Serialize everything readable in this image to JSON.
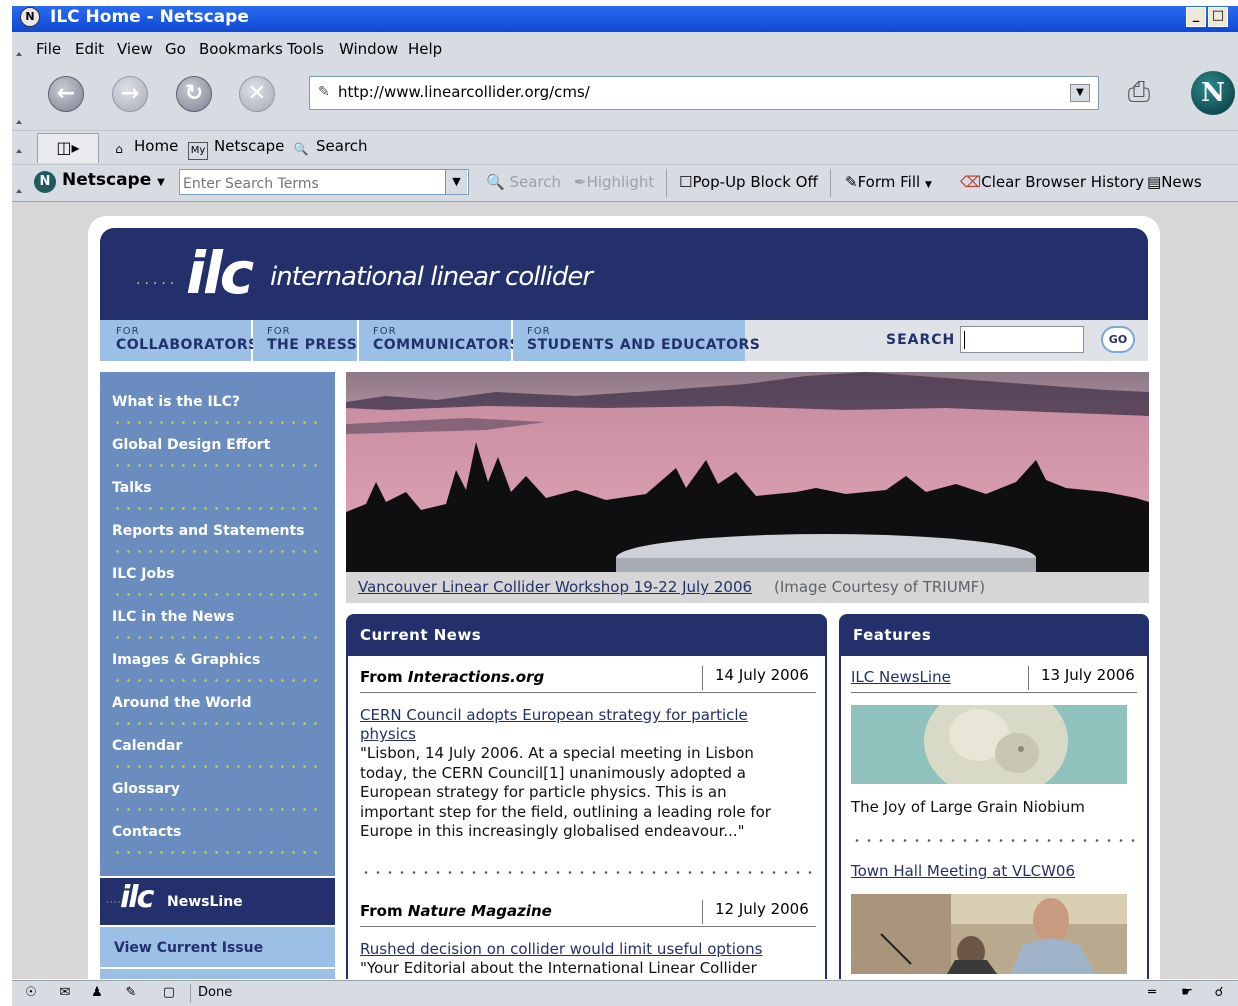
{
  "window": {
    "title": "ILC Home - Netscape",
    "controls": [
      "_",
      "□"
    ]
  },
  "menubar": [
    "File",
    "Edit",
    "View",
    "Go",
    "Bookmarks",
    "Tools",
    "Window",
    "Help"
  ],
  "navigation": {
    "url": "http://www.linearcollider.org/cms/"
  },
  "personal_toolbar": {
    "home": "Home",
    "netscape": "Netscape",
    "search": "Search"
  },
  "search_toolbar": {
    "brand": "Netscape",
    "search_placeholder": "Enter Search Terms",
    "search_btn": "Search",
    "highlight_btn": "Highlight",
    "popup": "Pop-Up Block Off",
    "formfill": "Form Fill",
    "clear_history": "Clear Browser History",
    "news": "News"
  },
  "status": {
    "text": "Done"
  },
  "site": {
    "logo_text": "ilc",
    "name": "international linear collider",
    "audience_tabs": [
      {
        "for": "FOR",
        "label": "COLLABORATORS"
      },
      {
        "for": "FOR",
        "label": "THE PRESS"
      },
      {
        "for": "FOR",
        "label": "COMMUNICATORS"
      },
      {
        "for": "FOR",
        "label": "STUDENTS AND EDUCATORS"
      }
    ],
    "search_label": "SEARCH",
    "go_label": "GO",
    "left_nav": [
      "What is the ILC?",
      "Global Design Effort",
      "Talks",
      "Reports and Statements",
      "ILC Jobs",
      "ILC in the News",
      "Images & Graphics",
      "Around the World",
      "Calendar",
      "Glossary",
      "Contacts"
    ],
    "newsline": {
      "logo": "ilc",
      "label": "NewsLine",
      "view_issue": "View Current Issue"
    },
    "hero_caption": {
      "link": "Vancouver Linear Collider Workshop 19-22 July 2006",
      "credit": "(Image Courtesy of TRIUMF)"
    },
    "current_news": {
      "heading": "Current News",
      "items": [
        {
          "source_prefix": "From",
          "source": "Interactions.org",
          "date": "14 July 2006",
          "headline": "CERN Council adopts European strategy for particle physics",
          "excerpt": "\"Lisbon, 14 July 2006. At a special meeting in Lisbon today, the CERN Council[1] unanimously adopted a European strategy for particle physics. This is an important step for the field, outlining a leading role for Europe in this increasingly globalised endeavour...\""
        },
        {
          "source_prefix": "From",
          "source": "Nature Magazine",
          "date": "12 July 2006",
          "headline": "Rushed decision on collider would limit useful options",
          "excerpt": "\"Your Editorial about the International Linear Collider"
        }
      ]
    },
    "features": {
      "heading": "Features",
      "items": [
        {
          "title": "ILC NewsLine",
          "date": "13 July 2006",
          "caption": "The Joy of Large Grain Niobium"
        },
        {
          "title": "Town Hall Meeting at VLCW06"
        }
      ]
    }
  }
}
